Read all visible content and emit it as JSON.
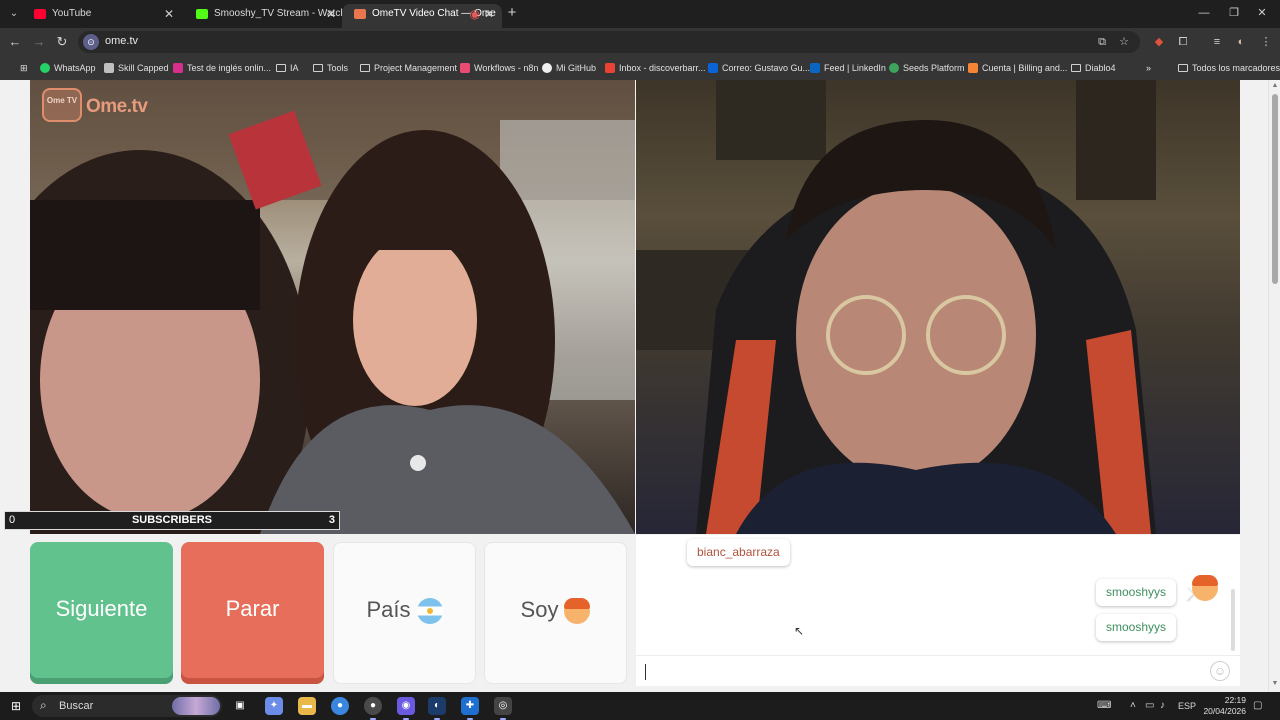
{
  "browser": {
    "tabs": [
      {
        "title": "YouTube",
        "active": false,
        "icon_color": "#ff0033"
      },
      {
        "title": "Smooshy_TV Stream - Watch Li",
        "active": false,
        "icon_color": "#53fc18"
      },
      {
        "title": "OmeTV Video Chat — Ome",
        "active": true,
        "icon_color": "#e8764f"
      }
    ],
    "url": "ome.tv",
    "bookmarks": [
      {
        "label": "WhatsApp",
        "icon": "whatsapp-icon",
        "color": "#25d366"
      },
      {
        "label": "Skill Capped",
        "icon": "skillcapped-icon",
        "color": "#bfbfbf"
      },
      {
        "label": "Test de inglés onlin...",
        "icon": "ef-icon",
        "color": "#d62f8c"
      },
      {
        "label": "IA",
        "icon": "folder-icon",
        "color": "folder"
      },
      {
        "label": "Tools",
        "icon": "folder-icon",
        "color": "folder"
      },
      {
        "label": "Project Management",
        "icon": "folder-icon",
        "color": "folder"
      },
      {
        "label": "Workflows - n8n",
        "icon": "n8n-icon",
        "color": "#ea4b71"
      },
      {
        "label": "Mi GitHub",
        "icon": "github-icon",
        "color": "#f0f0f0"
      },
      {
        "label": "Inbox - discoverbarr...",
        "icon": "gmail-icon",
        "color": "#ea4335"
      },
      {
        "label": "Correo: Gustavo Gu...",
        "icon": "outlook-icon",
        "color": "#0a64d6"
      },
      {
        "label": "Feed | LinkedIn",
        "icon": "linkedin-icon",
        "color": "#0a66c2"
      },
      {
        "label": "Seeds Platform",
        "icon": "seeds-icon",
        "color": "#3da35d"
      },
      {
        "label": "Cuenta | Billing and...",
        "icon": "aws-icon",
        "color": "#f58534"
      },
      {
        "label": "Diablo4",
        "icon": "folder-icon",
        "color": "folder"
      }
    ],
    "bookmarks_more": "»",
    "all_bookmarks": "Todos los marcadores"
  },
  "ometv": {
    "logo_badge": "Ome TV",
    "logo_text": "Ome.tv",
    "subscribers": {
      "left_count": "0",
      "label": "SUBSCRIBERS",
      "right_count": "3"
    },
    "buttons": {
      "next": "Siguiente",
      "stop": "Parar",
      "country": "País",
      "gender": "Soy"
    },
    "colors": {
      "next": "#61c28e",
      "stop": "#e66e5a"
    },
    "chat": {
      "partner_name": "bianc_abarraza",
      "messages": [
        "smooshyys",
        "smooshyys"
      ]
    }
  },
  "taskbar": {
    "search_placeholder": "Buscar",
    "language": "ESP",
    "time": "22:19",
    "date": "20/04/2026"
  }
}
